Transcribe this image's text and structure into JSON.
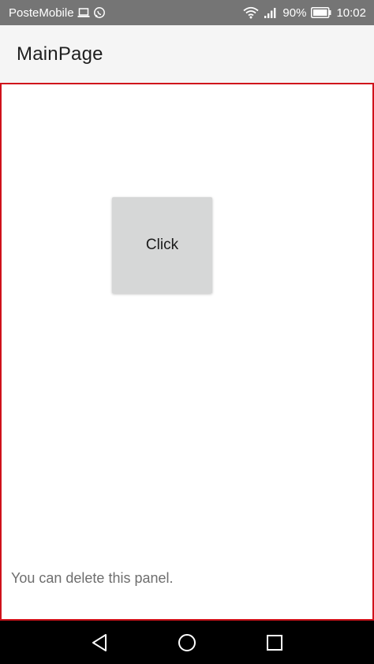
{
  "status_bar": {
    "carrier": "PosteMobile",
    "battery": "90%",
    "time": "10:02",
    "icons": [
      "laptop-icon",
      "whatsapp-icon",
      "wifi-icon",
      "signal-icon",
      "battery-icon"
    ]
  },
  "app_bar": {
    "title": "MainPage"
  },
  "content": {
    "button_label": "Click",
    "note": "You can delete this panel.",
    "border_color": "#d0121b",
    "button_color": "#d6d7d7"
  },
  "nav_bar": {
    "icons": [
      "back-icon",
      "home-icon",
      "recents-icon"
    ]
  }
}
